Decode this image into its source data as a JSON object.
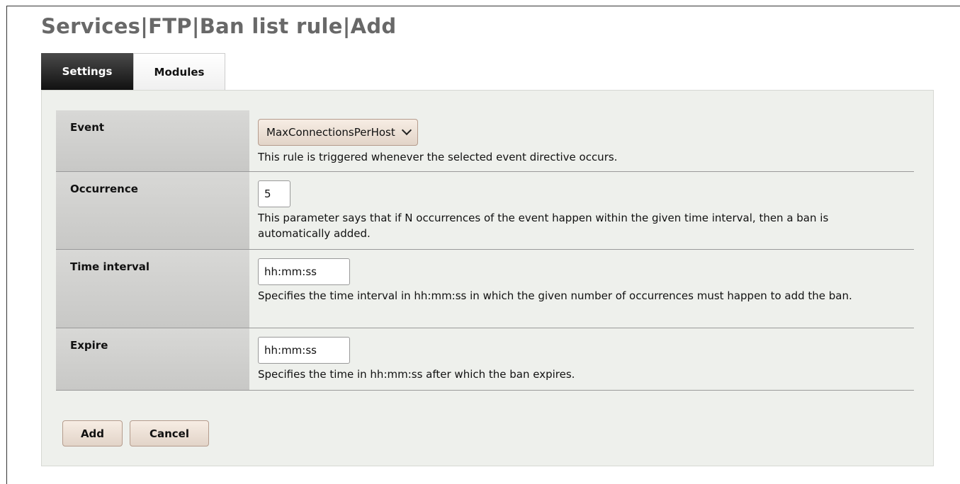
{
  "page": {
    "title": "Services|FTP|Ban list rule|Add"
  },
  "tabs": [
    {
      "label": "Settings",
      "active": true
    },
    {
      "label": "Modules",
      "active": false
    }
  ],
  "form": {
    "event": {
      "label": "Event",
      "selected": "MaxConnectionsPerHost",
      "help": "This rule is triggered whenever the selected event directive occurs."
    },
    "occurrence": {
      "label": "Occurrence",
      "value": "5",
      "help": "This parameter says that if N occurrences of the event happen within the given time interval, then a ban is automatically added."
    },
    "time_interval": {
      "label": "Time interval",
      "value": "hh:mm:ss",
      "help": "Specifies the time interval in hh:mm:ss in which the given number of occurrences must happen to add the ban."
    },
    "expire": {
      "label": "Expire",
      "value": "hh:mm:ss",
      "help": "Specifies the time in hh:mm:ss after which the ban expires."
    }
  },
  "buttons": {
    "add_label": "Add",
    "cancel_label": "Cancel"
  },
  "icons": {
    "select_arrow": "chevron-down-icon"
  },
  "colors": {
    "title": "#686868",
    "tab_active_bg": "#1a1a1a",
    "panel_bg": "#eef0ec",
    "label_cell_bg": "#d0d0ce",
    "button_bg": "#eadfd5",
    "button_border": "#b59c8d"
  }
}
